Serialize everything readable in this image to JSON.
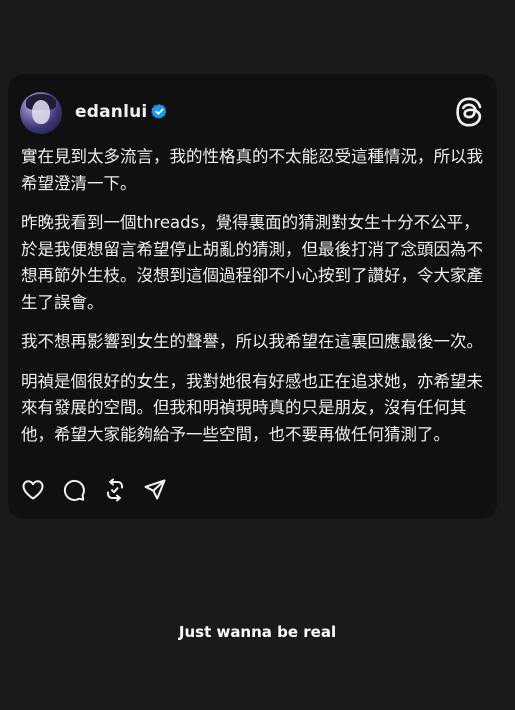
{
  "post": {
    "username": "edanlui",
    "verified": true,
    "icons": {
      "verified": "verified-badge-icon",
      "platform": "threads-logo-icon"
    },
    "paragraphs": [
      "實在見到太多流言，我的性格真的不太能忍受這種情況，所以我希望澄清一下。",
      "昨晚我看到一個threads，覺得裏面的猜測對女生十分不公平，於是我便想留言希望停止胡亂的猜測，但最後打消了念頭因為不想再節外生枝。沒想到這個過程卻不小心按到了讚好，令大家產生了誤會。",
      "我不想再影響到女生的聲譽，所以我希望在這裏回應最後一次。",
      "明禎是個很好的女生，我對她很有好感也正在追求她，亦希望未來有發展的空間。但我和明禎現時真的只是朋友，沒有任何其他，希望大家能夠給予一些空間，也不要再做任何猜測了。"
    ],
    "actions": [
      "heart-icon",
      "comment-icon",
      "repost-icon",
      "share-icon"
    ]
  },
  "caption": "Just wanna be real",
  "colors": {
    "background": "#1a1a1a",
    "card": "#101010",
    "verified": "#1d9bf0",
    "text": "#f2f2f2"
  }
}
